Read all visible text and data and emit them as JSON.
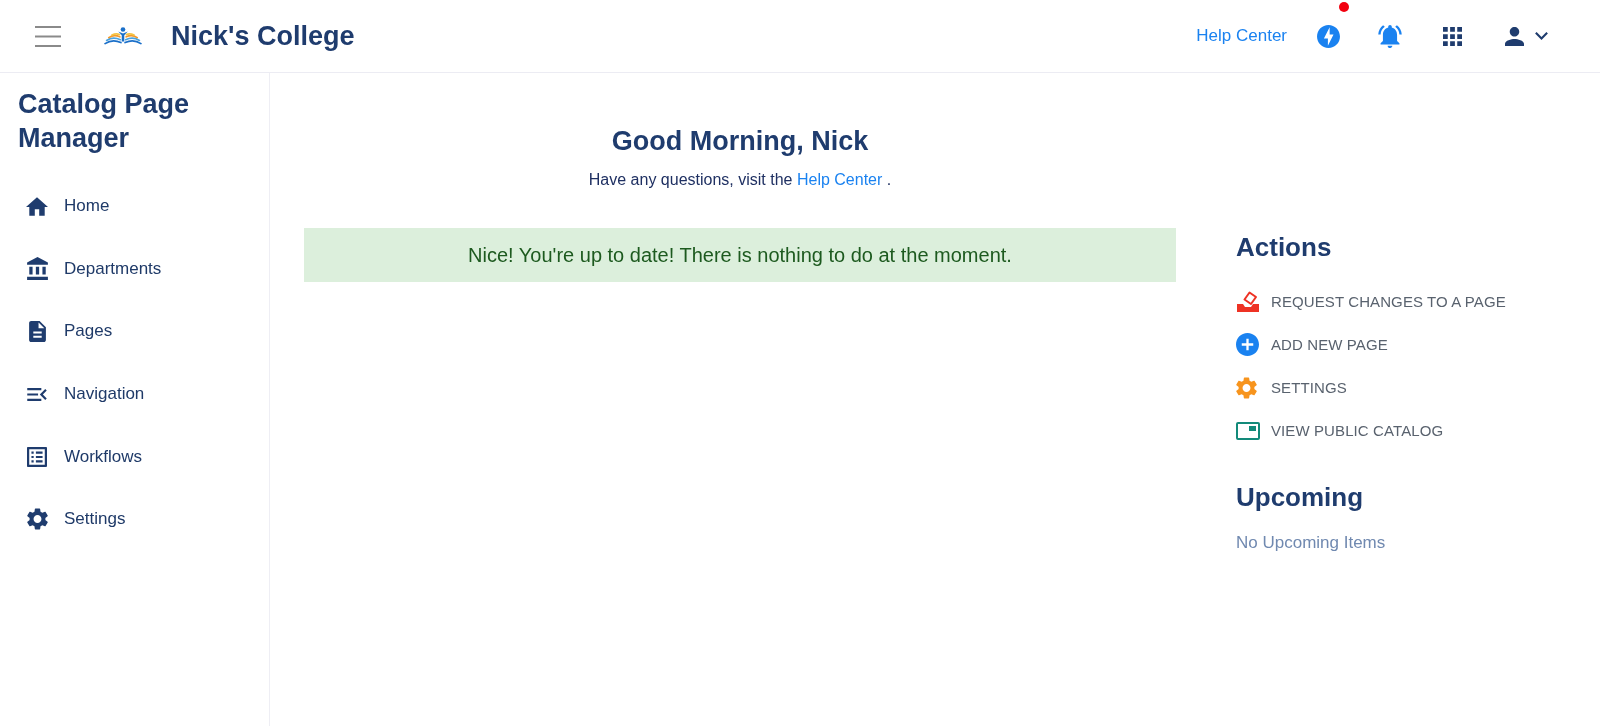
{
  "header": {
    "college_name": "Nick's College",
    "help_link": "Help Center",
    "has_alert": true
  },
  "sidebar": {
    "title": "Catalog Page Manager",
    "items": [
      {
        "label": "Home",
        "selected": false
      },
      {
        "label": "Departments",
        "selected": false
      },
      {
        "label": "Pages",
        "selected": false
      },
      {
        "label": "Navigation",
        "selected": false
      },
      {
        "label": "Workflows",
        "selected": false
      },
      {
        "label": "Settings",
        "selected": false
      }
    ]
  },
  "greeting": {
    "title": "Good Morning, Nick",
    "text_before": "Have any questions, visit the",
    "link": "Help Center",
    "text_after": "."
  },
  "status_message": "Nice! You're up to date! There is nothing to do at the moment.",
  "actions": {
    "title": "Actions",
    "items": [
      "REQUEST CHANGES TO A PAGE",
      "ADD NEW PAGE",
      "SETTINGS",
      "VIEW PUBLIC CATALOG"
    ]
  },
  "upcoming": {
    "title": "Upcoming",
    "empty_text": "No Upcoming Items"
  }
}
